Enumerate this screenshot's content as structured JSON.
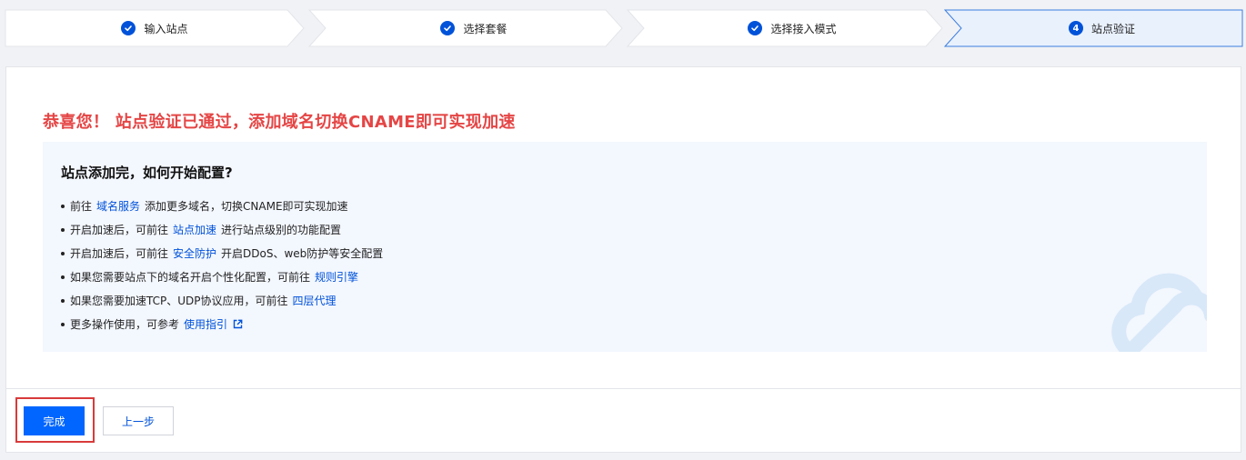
{
  "stepper": {
    "steps": [
      {
        "label": "输入站点",
        "status": "done"
      },
      {
        "label": "选择套餐",
        "status": "done"
      },
      {
        "label": "选择接入模式",
        "status": "done"
      },
      {
        "label": "站点验证",
        "status": "current",
        "number": "4"
      }
    ]
  },
  "main": {
    "headline": "恭喜您！ 站点验证已通过，添加域名切换CNAME即可实现加速",
    "guide": {
      "title": "站点添加完，如何开始配置?",
      "items": [
        {
          "before": "前往",
          "link": "域名服务",
          "after": "添加更多域名，切换CNAME即可实现加速"
        },
        {
          "before": "开启加速后，可前往",
          "link": "站点加速",
          "after": "进行站点级别的功能配置"
        },
        {
          "before": "开启加速后，可前往",
          "link": "安全防护",
          "after": "开启DDoS、web防护等安全配置"
        },
        {
          "before": "如果您需要站点下的域名开启个性化配置，可前往",
          "link": "规则引擎",
          "after": ""
        },
        {
          "before": "如果您需要加速TCP、UDP协议应用，可前往",
          "link": "四层代理",
          "after": ""
        },
        {
          "before": "更多操作使用，可参考",
          "link": "使用指引",
          "after": "",
          "icon": "external-link-icon"
        }
      ]
    }
  },
  "footer": {
    "finish_label": "完成",
    "prev_label": "上一步"
  },
  "colors": {
    "accent": "#0052d9",
    "primary_button": "#0066ff",
    "headline": "#e54545",
    "highlight_border": "#d93a3a",
    "current_step_bg": "#e9f1fd"
  }
}
